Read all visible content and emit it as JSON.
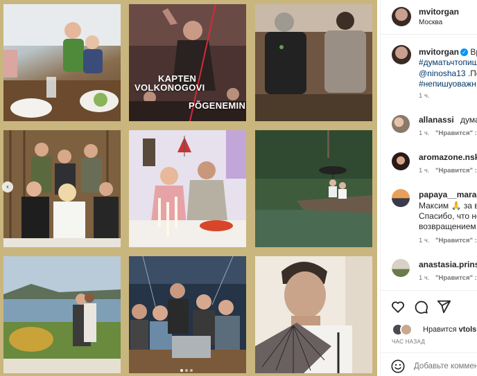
{
  "grid": {
    "tile2_caption_line1": "KAPTEN",
    "tile2_caption_line2": "VOLKONOGOVI",
    "tile2_caption_line3": "PÕGENEMINE"
  },
  "post": {
    "author": "mvitorgan",
    "location": "Москва",
    "caption_start": "Вр",
    "caption_line2": "#думатьчтопише",
    "caption_line3_mention": "@ninosha13",
    "caption_line3_rest": " .По",
    "caption_line4": "#непишуоважн",
    "caption_time": "1 ч."
  },
  "comments": [
    {
      "user": "allanassi",
      "text": "думать",
      "time": "1 ч.",
      "likes": "\"Нравится\" :"
    },
    {
      "user": "aromazone.nska",
      "text": "",
      "time": "1 ч.",
      "likes": "\"Нравится\" :"
    },
    {
      "user": "papaya__maracu",
      "text": "",
      "line2": "Максим 🙏 за в",
      "line3": "Спасибо, что не",
      "line4": "возвращением",
      "time": "1 ч.",
      "likes": "\"Нравится\" :"
    },
    {
      "user": "anastasia.prinse",
      "text": "",
      "time": "1 ч.",
      "likes": "\"Нравится\" :"
    }
  ],
  "actions": {
    "likes_prefix": "Нравится",
    "likes_user": "vtols",
    "time_ago": "ЧАС НАЗАД"
  },
  "comment_input": {
    "placeholder": "Добавьте коммен"
  },
  "colors": {
    "frame": "#c9b67e",
    "link": "#00376b",
    "verified": "#0095f6"
  }
}
